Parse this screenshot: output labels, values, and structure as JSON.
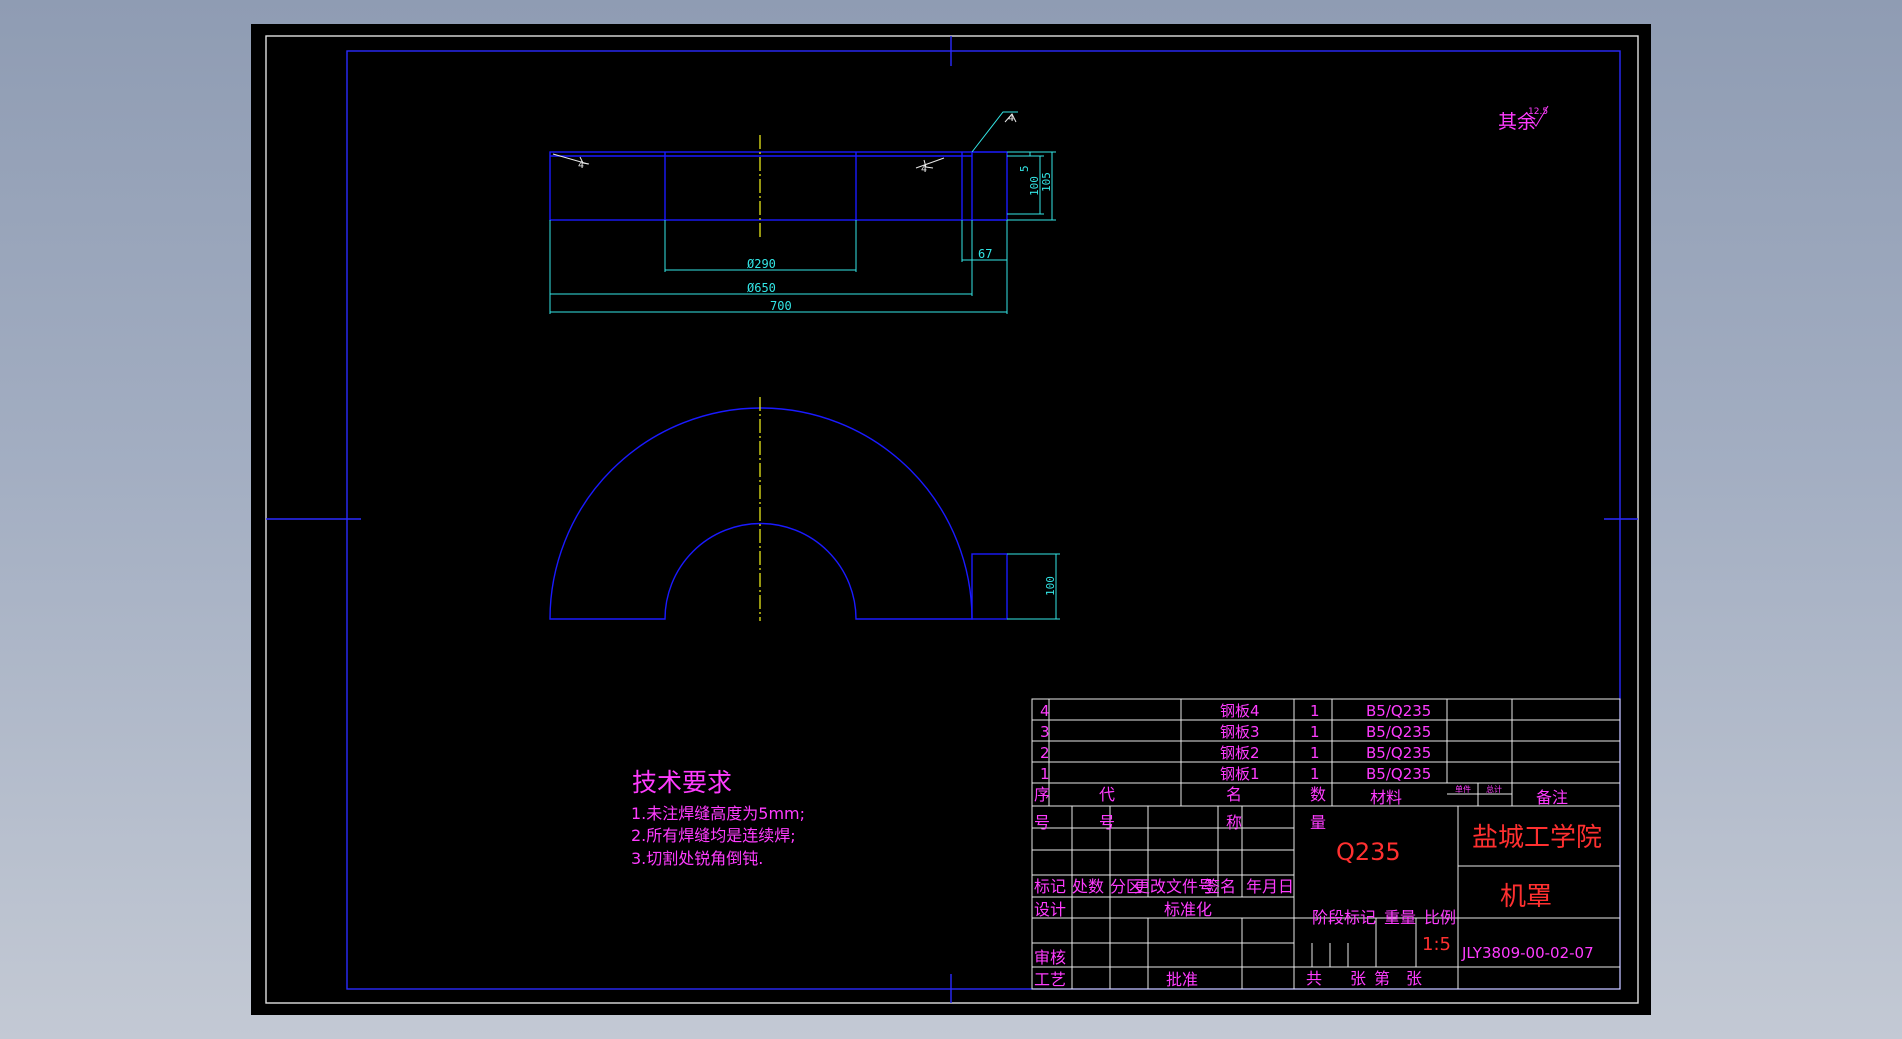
{
  "colors": {
    "background": "#8f9cb3",
    "sheet": "#000000",
    "geometry": "#1a1aff",
    "dimension": "#33e6e6",
    "text_magenta": "#ff3cff",
    "text_red": "#ff3030",
    "centerline": "#e6e61a"
  },
  "views": {
    "front": {
      "dims": {
        "d290": "Ø290",
        "d650": "Ø650",
        "w700": "700",
        "d67": "67",
        "d5": "5",
        "d100": "100",
        "d105": "105",
        "weld": "4"
      }
    },
    "top": {
      "dim_100": "100"
    }
  },
  "roughness": {
    "label": "其余",
    "value": "12.5"
  },
  "tech_req": {
    "title": "技术要求",
    "items": [
      "1.未注焊缝高度为5mm;",
      "2.所有焊缝均是连续焊;",
      "3.切割处锐角倒钝."
    ]
  },
  "bom": {
    "rows": [
      {
        "no": "4",
        "name": "钢板4",
        "qty": "1",
        "material": "B5/Q235"
      },
      {
        "no": "3",
        "name": "钢板3",
        "qty": "1",
        "material": "B5/Q235"
      },
      {
        "no": "2",
        "name": "钢板2",
        "qty": "1",
        "material": "B5/Q235"
      },
      {
        "no": "1",
        "name": "钢板1",
        "qty": "1",
        "material": "B5/Q235"
      }
    ],
    "header": {
      "xu": "序",
      "hao": "号",
      "dai": "代",
      "hao2": "号",
      "ming": "名",
      "cheng": "称",
      "shu": "数",
      "liang": "量",
      "material": "材料",
      "w1": "单件",
      "w2": "总计",
      "note": "备注"
    }
  },
  "title_block": {
    "material": "Q235",
    "school": "盐城工学院",
    "part_name": "机罩",
    "drawing_no": "JLY3809-00-02-07",
    "scale": "1:5",
    "rev_header": [
      "标记",
      "处数",
      "分区",
      "更改文件号",
      "签名",
      "年月日"
    ],
    "design": "设计",
    "standard": "标准化",
    "check": "审核",
    "craft": "工艺",
    "approve": "批准",
    "stage_mark": "阶段标记",
    "weight": "重量",
    "ratio": "比例",
    "sheets": [
      "共",
      "张",
      "第",
      "张"
    ]
  }
}
